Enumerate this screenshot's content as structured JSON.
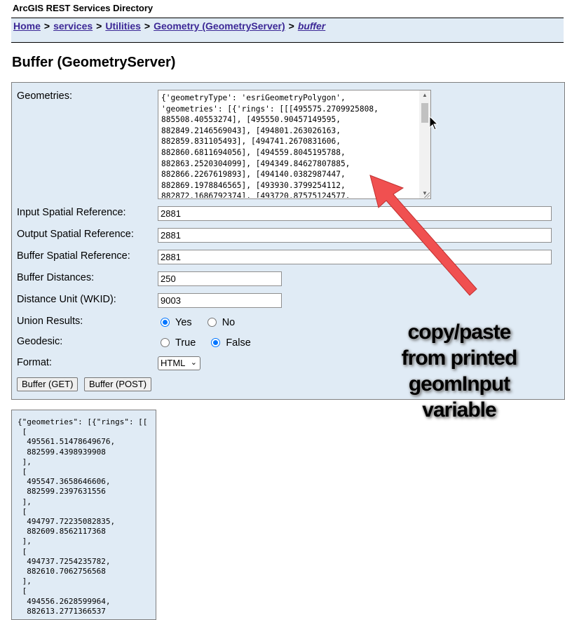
{
  "header": {
    "title": "ArcGIS REST Services Directory"
  },
  "breadcrumb": {
    "items": [
      "Home",
      "services",
      "Utilities",
      "Geometry (GeometryServer)"
    ],
    "separator": ">",
    "current": "buffer"
  },
  "page_title": "Buffer (GeometryServer)",
  "form": {
    "geometries_label": "Geometries:",
    "geometries_value": "{'geometryType': 'esriGeometryPolygon',\n'geometries': [{'rings': [[[495575.2709925808,\n885508.40553274], [495550.90457149595,\n882849.2146569043], [494801.263026163,\n882859.831105493], [494741.2670831606,\n882860.6811694056], [494559.8045195788,\n882863.2520304099], [494349.84627807885,\n882866.2267619893], [494140.0382987447,\n882869.1978846565], [493930.3799254112,\n882872.1686792374], [493720.87575124577,",
    "input_sr_label": "Input Spatial Reference:",
    "input_sr_value": "2881",
    "output_sr_label": "Output Spatial Reference:",
    "output_sr_value": "2881",
    "buffer_sr_label": "Buffer Spatial Reference:",
    "buffer_sr_value": "2881",
    "distances_label": "Buffer Distances:",
    "distances_value": "250",
    "unit_label": "Distance Unit (WKID):",
    "unit_value": "9003",
    "union_label": "Union Results:",
    "union_options": [
      "Yes",
      "No"
    ],
    "union_selected": "Yes",
    "geodesic_label": "Geodesic:",
    "geodesic_options": [
      "True",
      "False"
    ],
    "geodesic_selected": "False",
    "format_label": "Format:",
    "format_value": "HTML",
    "buffer_get_label": "Buffer (GET)",
    "buffer_post_label": "Buffer (POST)"
  },
  "result": {
    "text": "{\"geometries\": [{\"rings\": [[\n [\n  495561.51478649676,\n  882599.4398939908\n ],\n [\n  495547.3658646606,\n  882599.2397631556\n ],\n [\n  494797.72235082835,\n  882609.8562117368\n ],\n [\n  494737.7254235782,\n  882610.7062756568\n ],\n [\n  494556.2628599964,\n  882613.2771366537"
  },
  "annotation": {
    "lines": [
      "copy/paste",
      "from printed",
      "geomInput",
      "variable"
    ],
    "arrow_color": "#f05050"
  },
  "icons": {
    "scroll_up": "▲",
    "scroll_down": "▼",
    "select_chevron": "⌄"
  }
}
